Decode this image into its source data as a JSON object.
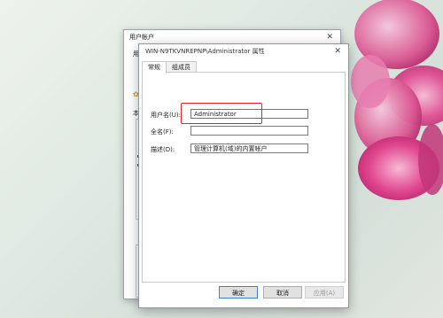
{
  "back_window": {
    "title": "用户帐户",
    "side_label_1": "用",
    "side_label_2": "本"
  },
  "front_window": {
    "title": "WIN-N9TKVNREPNP\\Administrator 属性",
    "tabs": [
      {
        "label": "常规"
      },
      {
        "label": "组成员"
      }
    ],
    "fields": {
      "username": {
        "label": "用户名(U):",
        "value": "Administrator"
      },
      "fullname": {
        "label": "全名(F):",
        "value": ""
      },
      "description": {
        "label": "描述(D):",
        "value": "管理计算机(域)的内置帐户"
      }
    },
    "buttons": {
      "ok": "确定",
      "cancel": "取消",
      "apply": "应用(A)"
    }
  },
  "colors": {
    "highlight": "#e0242a",
    "focus": "#3b7fd1",
    "flower": "#e0478f"
  }
}
